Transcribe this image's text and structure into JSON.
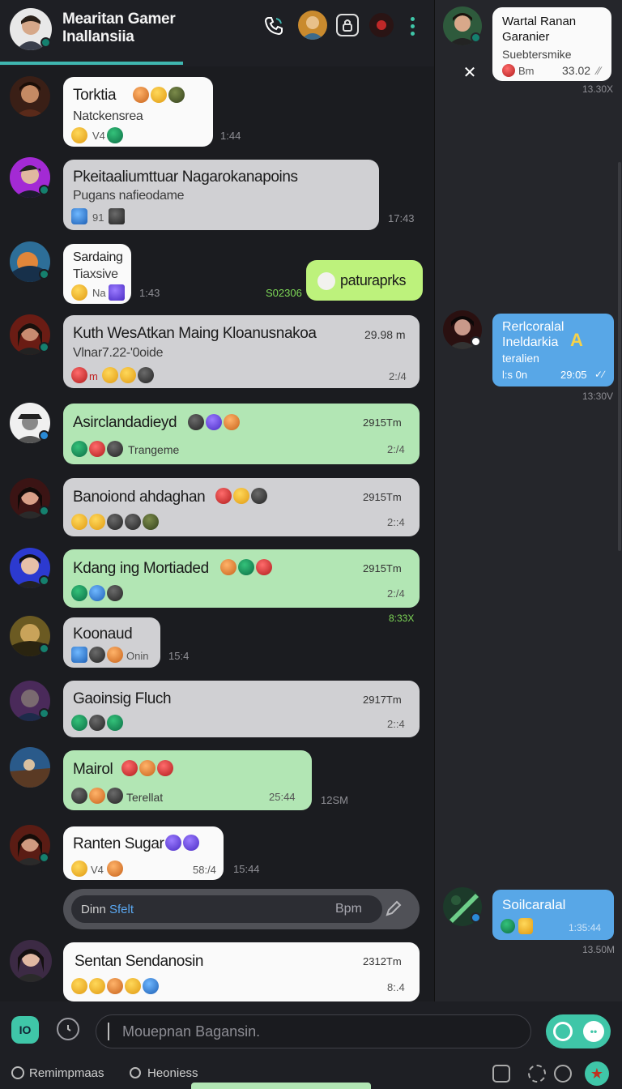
{
  "header": {
    "title_line1": "Mearitan Gamer",
    "title_line2": "Inallansiia",
    "icons": [
      "phone-icon",
      "group-avatar",
      "lock-icon",
      "record-icon",
      "more-vertical-icon"
    ]
  },
  "chats": [
    {
      "name": "Torktia",
      "sub": "Natckensrea",
      "meta": "V4",
      "time": "1:44"
    },
    {
      "name": "Pkeitaaliumttuar Nagarokanapoins",
      "sub": "Pugans nafieodame",
      "meta": "91",
      "time": "17:43"
    },
    {
      "name": "Sardaing",
      "sub": "Tiaxsive",
      "meta": "Na",
      "time": "1:43"
    },
    {
      "name": "Kuth WesAtkan  Maing Kloanusnakoa",
      "sub": "Vlnar7.22-'0oide",
      "meta": "m",
      "time_top": "29.98 m",
      "time": "2:/4"
    },
    {
      "name": "Asirclandadieyd",
      "sub": "Trangeme",
      "time_top": "2915Tm",
      "time": "2:/4"
    },
    {
      "name": "Banoiond ahdaghan",
      "time_top": "2915Tm",
      "time": "2::4"
    },
    {
      "name": "Kdang ing Mortiaded",
      "time_top": "2915Tm",
      "time": "2:/4",
      "ext": "8:33X"
    },
    {
      "name": "Koonaud",
      "meta": "Onin",
      "time": "15:4"
    },
    {
      "name": "Gaoinsig Fluch",
      "time_top": "2917Tm",
      "time": "2::4"
    },
    {
      "name": "Mairol",
      "sub": "Terellat",
      "time": "25:44",
      "ext": "12SM"
    },
    {
      "name": "Ranten Sugar",
      "meta": "V4",
      "time": "58:/4",
      "ext": "15:44"
    },
    {
      "name": "Sentan Sendanosin",
      "time_top": "2312Tm",
      "time": "8:.4"
    }
  ],
  "outgoing": {
    "text": "paturaprks",
    "time": "S02306"
  },
  "search": {
    "text": "Dinn",
    "accent": "Sfelt",
    "right": "Bpm"
  },
  "right_panel": {
    "card": {
      "title_line1": "Wartal Ranan",
      "title_line2": "Garanier",
      "sub": "Suebtersmike",
      "meta": "Bm",
      "time": "33.02",
      "ext": "13.30X"
    },
    "msg1": {
      "line1": "Rerlcoralal",
      "line2": "Ineldarkia",
      "line3": "teralien",
      "meta": "l:s 0n",
      "time": "29:05",
      "ext": "13:30V"
    },
    "msg2": {
      "line1": "Soilcaralal",
      "time": "1:35:44",
      "ext": "13.50M"
    }
  },
  "composer": {
    "placeholder": "Mouepnan Bagansin."
  },
  "bottom_nav": {
    "item1": "Remimpmaas",
    "item2": "Heoniess",
    "left_button": "IO"
  },
  "colors": {
    "accent": "#3fb6b0",
    "green_bubble": "#b2e6b4",
    "gray_bubble": "#d0d0d3",
    "blue_bubble": "#58a7e7",
    "lime_bubble": "#bdf27c",
    "send": "#3fc6a8"
  }
}
